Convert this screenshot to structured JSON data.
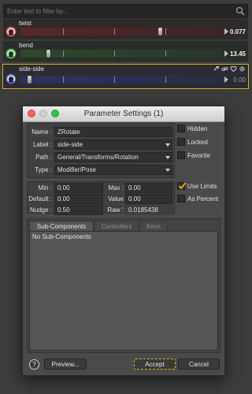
{
  "filter": {
    "placeholder": "Enter text to filter by..."
  },
  "properties": [
    {
      "name": "twist",
      "value": "0.077",
      "slider_fraction": 0.7
    },
    {
      "name": "bend",
      "value": "13.45",
      "slider_fraction": 0.14
    },
    {
      "name": "side-side",
      "value": "0.00",
      "slider_fraction": 0.04
    }
  ],
  "dialog": {
    "title": "Parameter Settings (1)",
    "name_label": "Name :",
    "name_value": "ZRotate",
    "label_label": "Label :",
    "label_value": "side-side",
    "path_label": "Path :",
    "path_value": "General/Transforms/Rotation",
    "type_label": "Type :",
    "type_value": "Modifier/Pose",
    "hidden_label": "Hidden",
    "locked_label": "Locked",
    "favorite_label": "Favorite",
    "min_label": "Min :",
    "min_value": "0.00",
    "max_label": "Max :",
    "max_value": "0.00",
    "default_label": "Default :",
    "default_value": "0.00",
    "value_label": "Value :",
    "value_value": "0.00",
    "nudge_label": "Nudge :",
    "nudge_value": "0.50",
    "raw_label": "Raw :",
    "raw_value": "0.0185438",
    "use_limits_label": "Use Limits",
    "use_limits_checked": true,
    "as_percent_label": "As Percent",
    "tabs": [
      "Sub-Components",
      "Controllers",
      "Keys"
    ],
    "sub_components_text": "No Sub-Components",
    "help_label": "?",
    "preview_label": "Preview...",
    "accept_label": "Accept",
    "cancel_label": "Cancel"
  },
  "colors": {
    "accent_highlight": "#d4b21e",
    "checkmark": "#f0b400"
  }
}
